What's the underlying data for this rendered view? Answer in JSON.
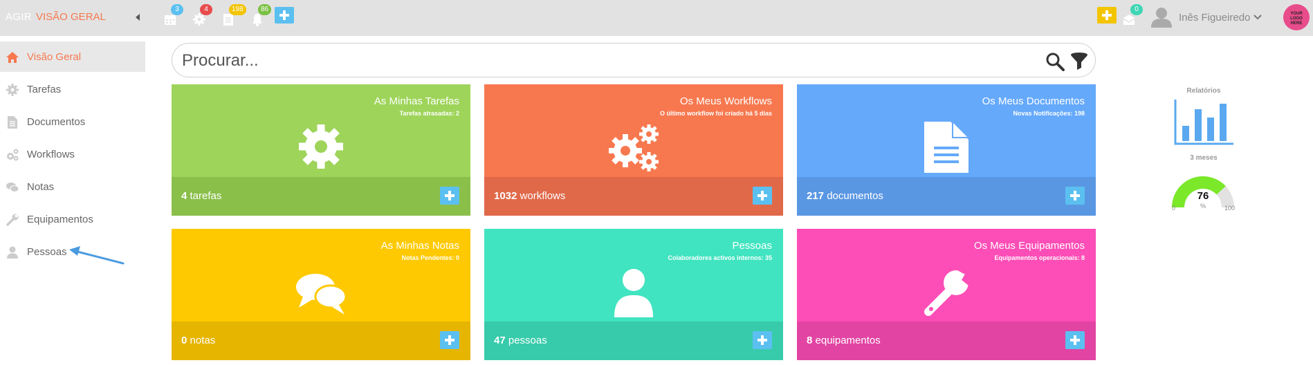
{
  "topbar": {
    "brand": "AGIR",
    "page": "VISÃO GERAL",
    "icons": [
      {
        "name": "calendar-icon",
        "badge": "3",
        "badge_color": "#5bc0f0"
      },
      {
        "name": "gear-icon",
        "badge": "4",
        "badge_color": "#e84c4c"
      },
      {
        "name": "document-icon",
        "badge": "198",
        "badge_color": "#f3c400"
      },
      {
        "name": "bell-icon",
        "badge": "86",
        "badge_color": "#7bc143"
      }
    ],
    "mail_badge": "0",
    "mail_badge_color": "#3fd6b5",
    "user_name": "Inês Figueiredo",
    "logo_text": [
      "YOUR",
      "LOGO",
      "HERE"
    ]
  },
  "sidebar": {
    "items": [
      {
        "label": "Visão Geral",
        "icon": "home-icon",
        "active": true
      },
      {
        "label": "Tarefas",
        "icon": "gear-icon"
      },
      {
        "label": "Documentos",
        "icon": "document-icon"
      },
      {
        "label": "Workflows",
        "icon": "gears-icon"
      },
      {
        "label": "Notas",
        "icon": "chat-icon"
      },
      {
        "label": "Equipamentos",
        "icon": "wrench-icon"
      },
      {
        "label": "Pessoas",
        "icon": "user-icon"
      }
    ]
  },
  "search": {
    "placeholder": "Procurar..."
  },
  "cards": [
    {
      "title": "As Minhas Tarefas",
      "subtitle": "Tarefas atrasadas: 2",
      "count": "4",
      "unit": "tarefas",
      "color_top": "#9ed45a",
      "color_bottom": "#8abf4a",
      "icon": "gear-icon"
    },
    {
      "title": "Os Meus Workflows",
      "subtitle": "O último workflow foi criado há 5 dias",
      "count": "1032",
      "unit": "workflows",
      "color_top": "#f7784f",
      "color_bottom": "#e0694a",
      "icon": "gears-icon"
    },
    {
      "title": "Os Meus Documentos",
      "subtitle": "Novas Notificações: 198",
      "count": "217",
      "unit": "documentos",
      "color_top": "#65a9fb",
      "color_bottom": "#5a97e3",
      "icon": "document-icon"
    },
    {
      "title": "As Minhas Notas",
      "subtitle": "Notas Pendentes: 0",
      "count": "0",
      "unit": "notas",
      "color_top": "#fec900",
      "color_bottom": "#e6b500",
      "icon": "chat-icon"
    },
    {
      "title": "Pessoas",
      "subtitle": "Colaboradores activos internos: 35",
      "count": "47",
      "unit": "pessoas",
      "color_top": "#41e4c0",
      "color_bottom": "#38cbab",
      "icon": "user-icon"
    },
    {
      "title": "Os Meus Equipamentos",
      "subtitle": "Equipamentos operacionais: 8",
      "count": "8",
      "unit": "equipamentos",
      "color_top": "#fc4eb6",
      "color_bottom": "#e244a3",
      "icon": "wrench-icon"
    }
  ],
  "reports": {
    "label": "Relatórios",
    "period": "3 meses",
    "gauge_value": 76,
    "gauge_unit": "%",
    "gauge_min": "0",
    "gauge_max": "100",
    "gauge_color": "#7be82a"
  }
}
